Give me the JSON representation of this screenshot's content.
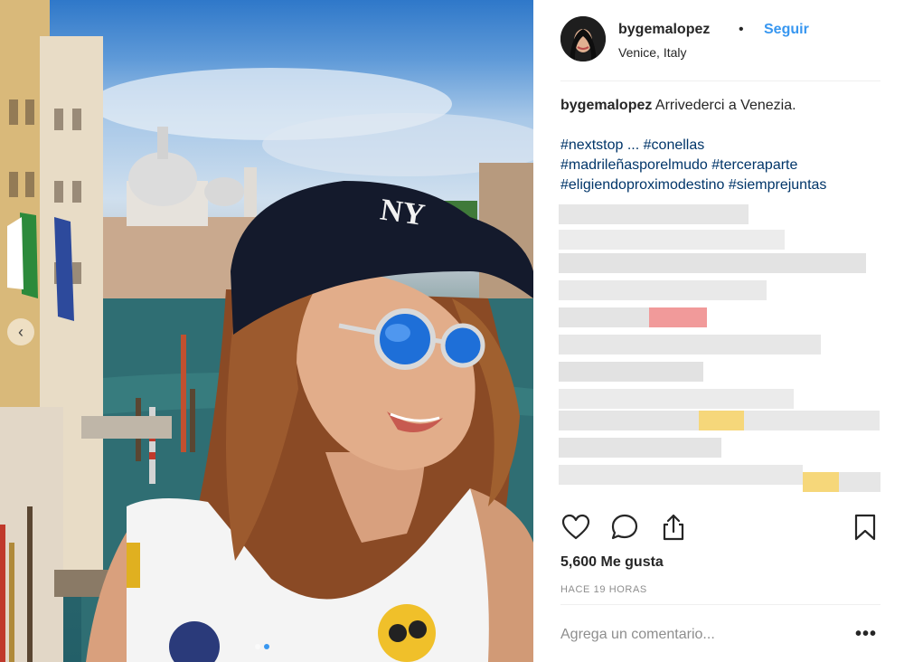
{
  "post": {
    "username": "bygemalopez",
    "bullet": "•",
    "follow_label": "Seguir",
    "location": "Venice, Italy",
    "caption_user": "bygemalopez",
    "caption_text": "Arrivederci a Venezia.",
    "hashtags": {
      "line1a": "#nextstop",
      "line1b": "...",
      "line1c": "#conellas",
      "line2a": "#madrileñasporelmudo",
      "line2b": "#terceraparte",
      "line3a": "#eligiendoproximodestino",
      "line3b": "#siemprejuntas"
    },
    "likes_label": "5,600 Me gusta",
    "time_label": "HACE 19 HORAS",
    "comment_placeholder": "Agrega un comentario...",
    "more_label": "•••"
  },
  "icons": {
    "heart": "heart-icon",
    "comment": "comment-icon",
    "share": "share-icon",
    "bookmark": "bookmark-icon",
    "carousel_prev": "chevron-left-icon"
  },
  "carousel": {
    "slides": 2,
    "active_index": 1
  },
  "colors": {
    "accent": "#3897f0",
    "hashtag": "#003569",
    "muted": "#8e8e8e",
    "text": "#262626"
  }
}
